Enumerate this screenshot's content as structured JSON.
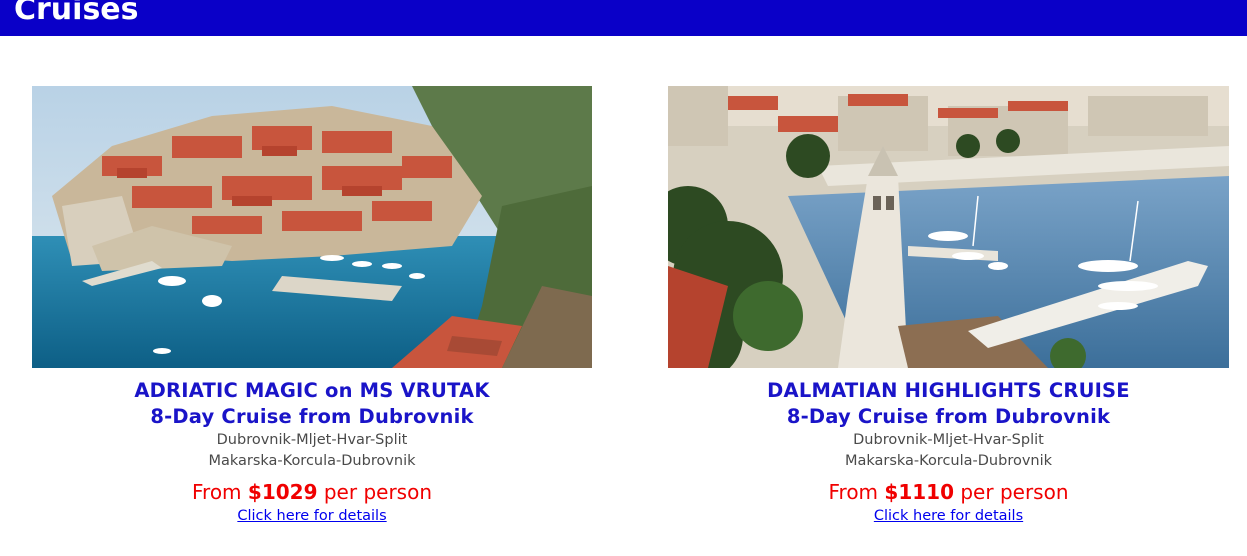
{
  "header": {
    "title": "Cruises",
    "background_color": "#0a00c8"
  },
  "cruises": [
    {
      "photo_icon": "dubrovnik-old-town-harbor-photo",
      "title": "ADRIATIC MAGIC on MS VRUTAK",
      "subtitle": "8-Day Cruise from Dubrovnik",
      "route_line1": "Dubrovnik-Mljet-Hvar-Split",
      "route_line2": "Makarska-Korcula-Dubrovnik",
      "price_prefix": "From ",
      "price_amount": "$1029",
      "price_suffix": " per person",
      "link_label": "Click here for details"
    },
    {
      "photo_icon": "dalmatian-bell-tower-marina-photo",
      "title": "DALMATIAN HIGHLIGHTS CRUISE",
      "subtitle": "8-Day Cruise from Dubrovnik",
      "route_line1": "Dubrovnik-Mljet-Hvar-Split",
      "route_line2": "Makarska-Korcula-Dubrovnik",
      "price_prefix": "From ",
      "price_amount": "$1110",
      "price_suffix": " per person",
      "link_label": "Click here for details"
    }
  ],
  "colors": {
    "title_blue": "#1a14c8",
    "price_red": "#f00000",
    "link_blue": "#0000ee"
  }
}
